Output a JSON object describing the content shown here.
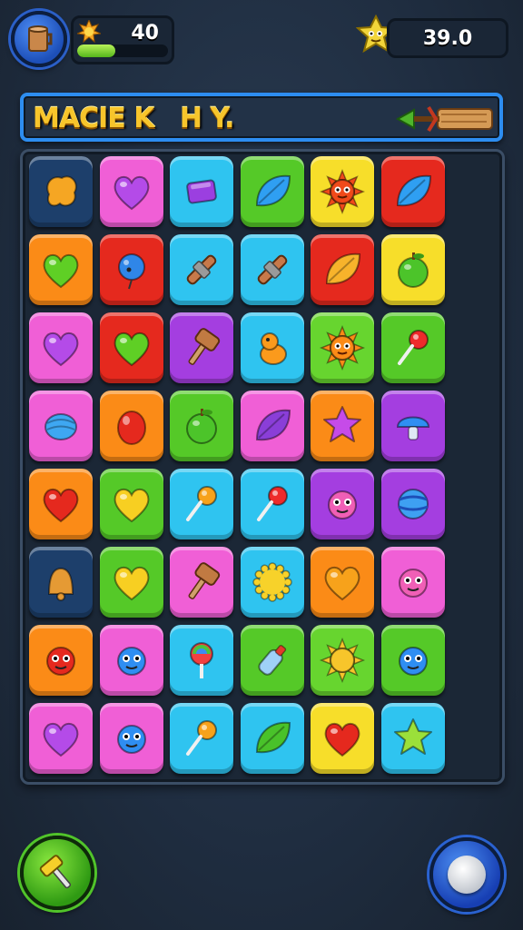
{
  "hud": {
    "avatar_icon": "wooden-barrel-icon",
    "level_value": "40",
    "xp_progress": 0.42,
    "coin_icon": "star-face-coin-icon",
    "score_value": "39.0"
  },
  "banner": {
    "title": "MACIE K   H Y.",
    "arrow_icon": "wooden-arrow-icon"
  },
  "colors": {
    "navy": "#1d3f6b",
    "pink": "#f05fd6",
    "cyan": "#2fc4f0",
    "green": "#55c928",
    "yellow": "#f7de2a",
    "red": "#e5291e",
    "orange": "#fb8b17",
    "purple": "#a43ee0",
    "lime": "#67d52f"
  },
  "board": {
    "rows": [
      [
        {
          "color": "navy",
          "icon": "orange-star-icon"
        },
        {
          "color": "pink",
          "icon": "purple-heart-icon"
        },
        {
          "color": "cyan",
          "icon": "purple-block-icon"
        },
        {
          "color": "green",
          "icon": "blue-leaf-icon"
        },
        {
          "color": "yellow",
          "icon": "red-sun-face-icon"
        },
        {
          "color": "red",
          "icon": "blue-leaf-icon"
        }
      ],
      [
        {
          "color": "orange",
          "icon": "green-heart-icon"
        },
        {
          "color": "red",
          "icon": "blue-balloon-icon"
        },
        {
          "color": "cyan",
          "icon": "rolling-pin-icon"
        },
        {
          "color": "cyan",
          "icon": "rolling-pin-icon"
        },
        {
          "color": "red",
          "icon": "orange-leaf-icon"
        },
        {
          "color": "yellow",
          "icon": "green-apple-icon"
        }
      ],
      [
        {
          "color": "pink",
          "icon": "purple-heart-icon"
        },
        {
          "color": "red",
          "icon": "green-heart-icon"
        },
        {
          "color": "purple",
          "icon": "wooden-mallet-icon"
        },
        {
          "color": "cyan",
          "icon": "orange-duck-icon"
        },
        {
          "color": "lime",
          "icon": "orange-sun-face-icon"
        },
        {
          "color": "green",
          "icon": "red-lollipop-icon"
        }
      ],
      [
        {
          "color": "pink",
          "icon": "blue-shell-icon"
        },
        {
          "color": "orange",
          "icon": "red-berry-icon"
        },
        {
          "color": "green",
          "icon": "green-apple-icon"
        },
        {
          "color": "pink",
          "icon": "purple-leaf-icon"
        },
        {
          "color": "orange",
          "icon": "purple-star-icon"
        },
        {
          "color": "purple",
          "icon": "blue-mushroom-icon"
        }
      ],
      [
        {
          "color": "orange",
          "icon": "red-heart-icon"
        },
        {
          "color": "green",
          "icon": "yellow-heart-icon"
        },
        {
          "color": "cyan",
          "icon": "orange-lollipop-icon"
        },
        {
          "color": "cyan",
          "icon": "red-lollipop-icon"
        },
        {
          "color": "purple",
          "icon": "pink-monster-icon"
        },
        {
          "color": "purple",
          "icon": "blue-ball-icon"
        }
      ],
      [
        {
          "color": "navy",
          "icon": "orange-bell-icon"
        },
        {
          "color": "green",
          "icon": "yellow-heart-icon"
        },
        {
          "color": "pink",
          "icon": "wooden-mallet-icon"
        },
        {
          "color": "cyan",
          "icon": "yellow-gear-icon"
        },
        {
          "color": "orange",
          "icon": "orange-heart-icon"
        },
        {
          "color": "pink",
          "icon": "pink-monster-icon"
        }
      ],
      [
        {
          "color": "orange",
          "icon": "red-monster-icon"
        },
        {
          "color": "pink",
          "icon": "blue-monster-icon"
        },
        {
          "color": "cyan",
          "icon": "rainbow-lollipop-icon"
        },
        {
          "color": "green",
          "icon": "blue-bottle-icon"
        },
        {
          "color": "lime",
          "icon": "yellow-sun-icon"
        },
        {
          "color": "green",
          "icon": "blue-monster-icon"
        }
      ],
      [
        {
          "color": "pink",
          "icon": "purple-heart-icon"
        },
        {
          "color": "pink",
          "icon": "blue-monster-icon"
        },
        {
          "color": "cyan",
          "icon": "orange-lollipop-icon"
        },
        {
          "color": "cyan",
          "icon": "green-leaf-icon"
        },
        {
          "color": "yellow",
          "icon": "red-heart-icon"
        },
        {
          "color": "cyan",
          "icon": "green-star-icon"
        }
      ]
    ]
  },
  "buttons": {
    "hammer_icon": "hammer-icon",
    "round_icon": "white-knob-icon"
  }
}
